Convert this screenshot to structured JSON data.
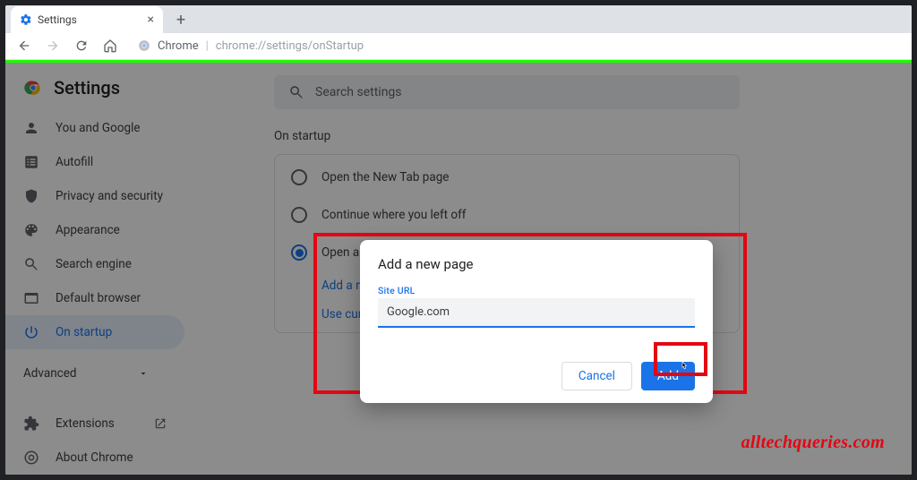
{
  "tab": {
    "title": "Settings"
  },
  "omnibox": {
    "label": "Chrome",
    "path": "chrome://settings/onStartup"
  },
  "sidebar": {
    "title": "Settings",
    "items": [
      {
        "label": "You and Google"
      },
      {
        "label": "Autofill"
      },
      {
        "label": "Privacy and security"
      },
      {
        "label": "Appearance"
      },
      {
        "label": "Search engine"
      },
      {
        "label": "Default browser"
      },
      {
        "label": "On startup"
      }
    ],
    "advanced": "Advanced",
    "extensions": "Extensions",
    "about": "About Chrome"
  },
  "main": {
    "search_placeholder": "Search settings",
    "section_title": "On startup",
    "radios": [
      {
        "label": "Open the New Tab page"
      },
      {
        "label": "Continue where you left off"
      },
      {
        "label": "Open a specific page or set of pages"
      }
    ],
    "add_link": "Add a new page",
    "use_link": "Use current pages"
  },
  "dialog": {
    "title": "Add a new page",
    "field_label": "Site URL",
    "field_value": "Google.com",
    "cancel": "Cancel",
    "add": "Add"
  },
  "watermark": "alltechqueries.com"
}
